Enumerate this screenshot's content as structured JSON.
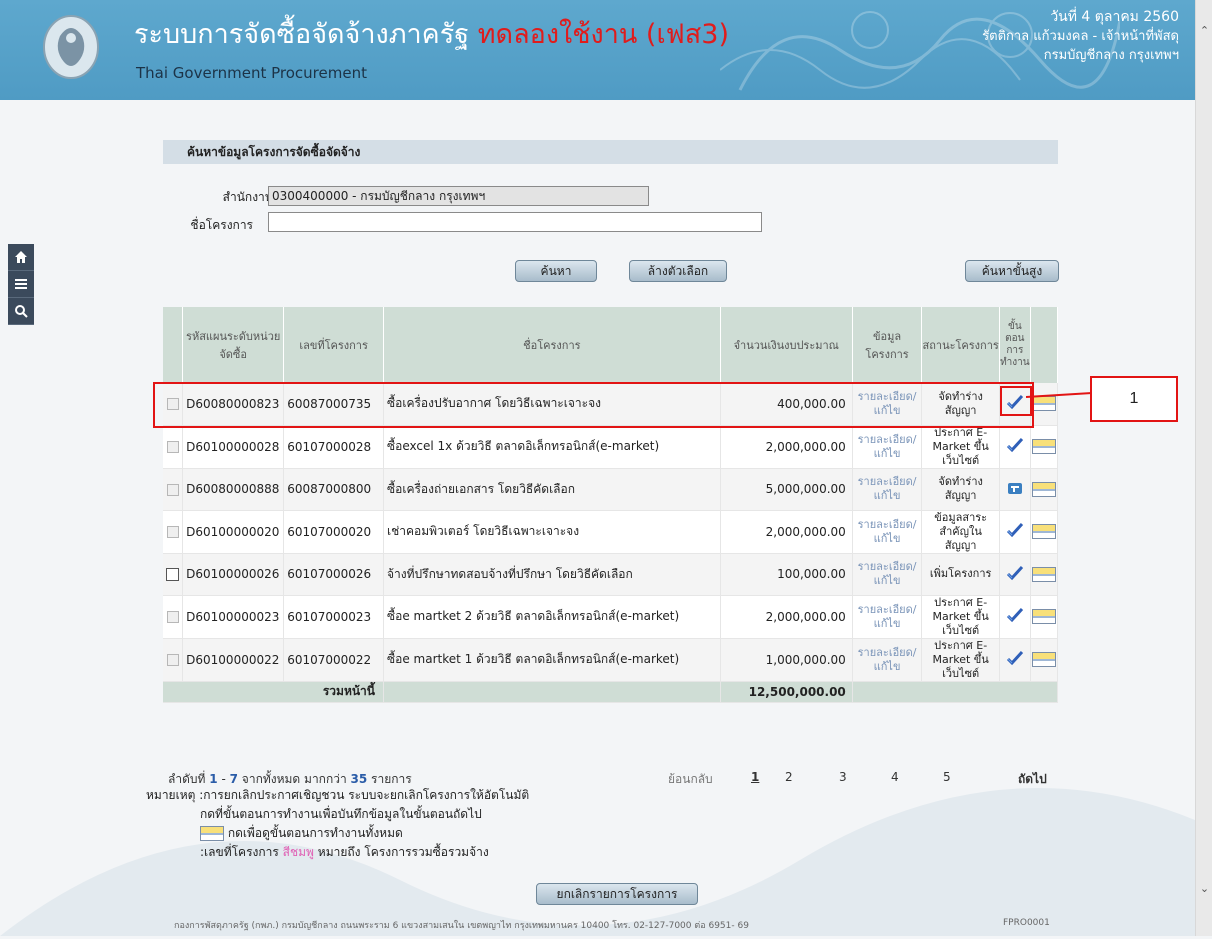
{
  "header": {
    "title_main": "ระบบการจัดซื้อจัดจ้างภาครัฐ",
    "title_trial": "ทดลองใช้งาน (เฟส3)",
    "subtitle": "Thai Government Procurement",
    "date": "วันที่ 4 ตุลาคม 2560",
    "user": "รัตติกาล แก้วมงคล - เจ้าหน้าที่พัสดุ",
    "org": "กรมบัญชีกลาง กรุงเทพฯ"
  },
  "search": {
    "section_title": "ค้นหาข้อมูลโครงการจัดซื้อจัดจ้าง",
    "office_label": "สำนักงาน",
    "office_value": "0300400000 - กรมบัญชีกลาง กรุงเทพฯ",
    "project_label": "ชื่อโครงการ",
    "project_value": "",
    "search_btn": "ค้นหา",
    "clear_btn": "ล้างตัวเลือก",
    "advanced_btn": "ค้นหาขั้นสูง"
  },
  "table": {
    "headers": {
      "plan_code": "รหัสแผนระดับหน่วยจัดซื้อ",
      "project_no": "เลขที่โครงการ",
      "project_name": "ชื่อโครงการ",
      "budget": "จำนวนเงินงบประมาณ",
      "info": "ข้อมูลโครงการ",
      "status": "สถานะโครงการ",
      "step": "ขั้นตอนการทำงาน"
    },
    "rows": [
      {
        "plan": "D60080000823",
        "no": "60087000735",
        "name": "ซื้อเครื่องปรับอากาศ โดยวิธีเฉพาะเจาะจง",
        "budget": "400,000.00",
        "link": "รายละเอียด/แก้ไข",
        "status": "จัดทำร่างสัญญา"
      },
      {
        "plan": "D60100000028",
        "no": "60107000028",
        "name": "ซื้อexcel 1x ด้วยวิธี ตลาดอิเล็กทรอนิกส์(e-market)",
        "budget": "2,000,000.00",
        "link": "รายละเอียด/แก้ไข",
        "status": "ประกาศ E-Market ขึ้นเว็บไซต์"
      },
      {
        "plan": "D60080000888",
        "no": "60087000800",
        "name": "ซื้อเครื่องถ่ายเอกสาร โดยวิธีคัดเลือก",
        "budget": "5,000,000.00",
        "link": "รายละเอียด/แก้ไข",
        "status": "จัดทำร่างสัญญา"
      },
      {
        "plan": "D60100000020",
        "no": "60107000020",
        "name": "เช่าคอมพิวเตอร์ โดยวิธีเฉพาะเจาะจง",
        "budget": "2,000,000.00",
        "link": "รายละเอียด/แก้ไข",
        "status": "ข้อมูลสาระสำคัญในสัญญา"
      },
      {
        "plan": "D60100000026",
        "no": "60107000026",
        "name": "จ้างที่ปรึกษาทดสอบจ้างที่ปรึกษา โดยวิธีคัดเลือก",
        "budget": "100,000.00",
        "link": "รายละเอียด/แก้ไข",
        "status": "เพิ่มโครงการ"
      },
      {
        "plan": "D60100000023",
        "no": "60107000023",
        "name": "ซื้อe martket 2 ด้วยวิธี ตลาดอิเล็กทรอนิกส์(e-market)",
        "budget": "2,000,000.00",
        "link": "รายละเอียด/แก้ไข",
        "status": "ประกาศ E-Market ขึ้นเว็บไซต์"
      },
      {
        "plan": "D60100000022",
        "no": "60107000022",
        "name": "ซื้อe martket 1 ด้วยวิธี ตลาดอิเล็กทรอนิกส์(e-market)",
        "budget": "1,000,000.00",
        "link": "รายละเอียด/แก้ไข",
        "status": "ประกาศ E-Market ขึ้นเว็บไซต์"
      }
    ],
    "total_label": "รวมหน้านี้",
    "total_value": "12,500,000.00"
  },
  "pager": {
    "summary_prefix": "ลำดับที่",
    "range_from": "1",
    "range_sep": "-",
    "range_to": "7",
    "summary_mid": "จากทั้งหมด มากกว่า",
    "total_count": "35",
    "summary_suffix": "รายการ",
    "back": "ย้อนกลับ",
    "pages": [
      "1",
      "2",
      "3",
      "4",
      "5"
    ],
    "next": "ถัดไป"
  },
  "notes": {
    "line1": "หมายเหตุ :การยกเลิกประกาศเชิญชวน ระบบจะยกเลิกโครงการให้อัตโนมัติ",
    "line2": "กดที่ขั้นตอนการทำงานเพื่อบันทึกข้อมูลในขั้นตอนถัดไป",
    "line3": "กดเพื่อดูขั้นตอนการทำงานทั้งหมด",
    "line4_prefix": ":เลขที่โครงการ",
    "line4_pink": "สีชมพู",
    "line4_suffix": "หมายถึง โครงการรวมซื้อรวมจ้าง"
  },
  "cancel_btn": "ยกเลิกรายการโครงการ",
  "footer": {
    "address": "กองการพัสดุภาครัฐ (กพภ.) กรมบัญชีกลาง ถนนพระราม 6 แขวงสามเสนใน เขตพญาไท กรุงเทพมหานคร 10400 โทร. 02-127-7000 ต่อ 6951- 69",
    "code": "FPRO0001"
  },
  "callout_label": "1",
  "colors": {
    "header_bg": "#5ea8ce",
    "table_header": "#cfddd5",
    "callout": "#e21414",
    "trial": "#e01c1c"
  }
}
